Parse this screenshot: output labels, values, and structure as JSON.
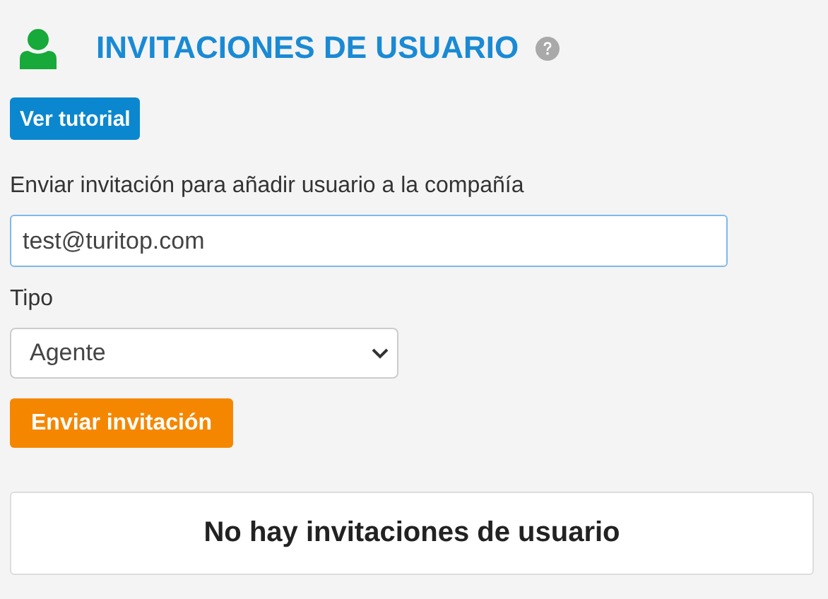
{
  "header": {
    "title": "INVITACIONES DE USUARIO"
  },
  "tutorial_button": "Ver tutorial",
  "invite_label": "Enviar invitación para añadir usuario a la compañía",
  "email_field": {
    "value": "test@turitop.com",
    "focused": true
  },
  "type_label": "Tipo",
  "type_select": {
    "value": "Agente"
  },
  "send_button": "Enviar invitación",
  "empty_message": "No hay invitaciones de usuario"
}
